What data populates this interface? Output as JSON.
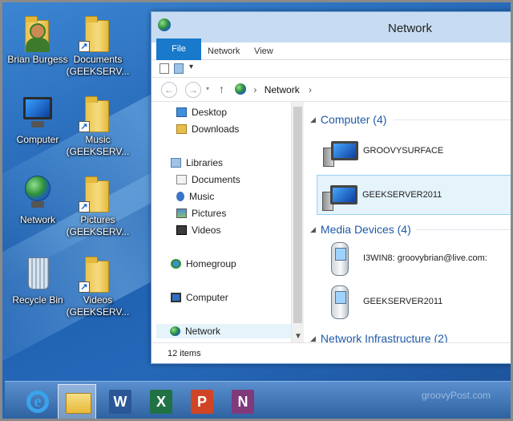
{
  "desktop": {
    "icons": [
      {
        "label": "Brian Burgess",
        "icon": "user-folder-icon"
      },
      {
        "label": "Documents (GEEKSERV...",
        "icon": "folder-shortcut-icon"
      },
      {
        "label": "Computer",
        "icon": "computer-icon"
      },
      {
        "label": "Music (GEEKSERV...",
        "icon": "folder-shortcut-icon"
      },
      {
        "label": "Network",
        "icon": "network-globe-icon"
      },
      {
        "label": "Pictures (GEEKSERV...",
        "icon": "folder-shortcut-icon"
      },
      {
        "label": "Recycle Bin",
        "icon": "recycle-bin-icon"
      },
      {
        "label": "Videos (GEEKSERV...",
        "icon": "folder-shortcut-icon"
      }
    ]
  },
  "window": {
    "title": "Network",
    "ribbon_tabs": {
      "file": "File",
      "network": "Network",
      "view": "View"
    },
    "qat_dropdown": "▾",
    "address": {
      "back": "←",
      "forward": "→",
      "up": "↑",
      "separator": "›",
      "location": "Network",
      "end_chevron": "›"
    },
    "nav": {
      "desktop": "Desktop",
      "downloads": "Downloads",
      "libraries": "Libraries",
      "documents": "Documents",
      "music": "Music",
      "pictures": "Pictures",
      "videos": "Videos",
      "homegroup": "Homegroup",
      "computer": "Computer",
      "network": "Network"
    },
    "groups": {
      "computer": "Computer (4)",
      "media": "Media Devices (4)",
      "infrastructure": "Network Infrastructure (2)"
    },
    "items": {
      "pc1": "GROOVYSURFACE",
      "pc2": "GEEKSERVER2011",
      "media1": "I3WIN8: groovybrian@live.com:",
      "media2": "GEEKSERVER2011"
    },
    "status": "12 items"
  },
  "taskbar": {
    "apps": [
      {
        "name": "Internet Explorer",
        "icon": "internet-explorer-icon",
        "glyph": "e"
      },
      {
        "name": "File Explorer",
        "icon": "file-explorer-icon",
        "glyph": ""
      },
      {
        "name": "Word",
        "icon": "word-icon",
        "glyph": "W",
        "color": "#2b5797"
      },
      {
        "name": "Excel",
        "icon": "excel-icon",
        "glyph": "X",
        "color": "#207245"
      },
      {
        "name": "PowerPoint",
        "icon": "powerpoint-icon",
        "glyph": "P",
        "color": "#d04525"
      },
      {
        "name": "OneNote",
        "icon": "onenote-icon",
        "glyph": "N",
        "color": "#80397b"
      }
    ],
    "watermark": "groovyPost.com"
  },
  "colors": {
    "accent": "#1979ca",
    "selection": "#e5f3fb",
    "group_header": "#1e5aa8"
  }
}
